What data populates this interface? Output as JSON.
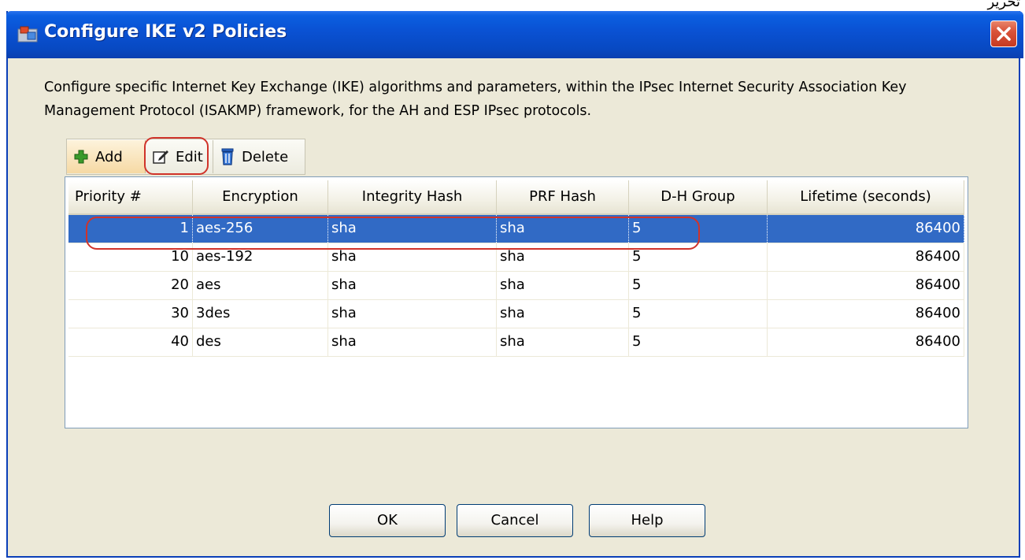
{
  "corner_text": "تحرير",
  "window": {
    "title": "Configure IKE v2 Policies"
  },
  "description": "Configure specific Internet Key Exchange (IKE) algorithms and parameters, within the IPsec Internet Security Association Key Management Protocol (ISAKMP) framework, for the AH and ESP IPsec protocols.",
  "toolbar": {
    "add_label": "Add",
    "edit_label": "Edit",
    "delete_label": "Delete"
  },
  "table": {
    "columns": [
      "Priority #",
      "Encryption",
      "Integrity Hash",
      "PRF Hash",
      "D-H Group",
      "Lifetime (seconds)"
    ],
    "rows": [
      [
        "1",
        "aes-256",
        "sha",
        "sha",
        "5",
        "86400"
      ],
      [
        "10",
        "aes-192",
        "sha",
        "sha",
        "5",
        "86400"
      ],
      [
        "20",
        "aes",
        "sha",
        "sha",
        "5",
        "86400"
      ],
      [
        "30",
        "3des",
        "sha",
        "sha",
        "5",
        "86400"
      ],
      [
        "40",
        "des",
        "sha",
        "sha",
        "5",
        "86400"
      ]
    ],
    "selected_row": 0
  },
  "buttons": {
    "ok": "OK",
    "cancel": "Cancel",
    "help": "Help"
  },
  "colors": {
    "selection": "#316ac5",
    "annotation": "#d0332a",
    "titlebar": "#0a52d4"
  }
}
